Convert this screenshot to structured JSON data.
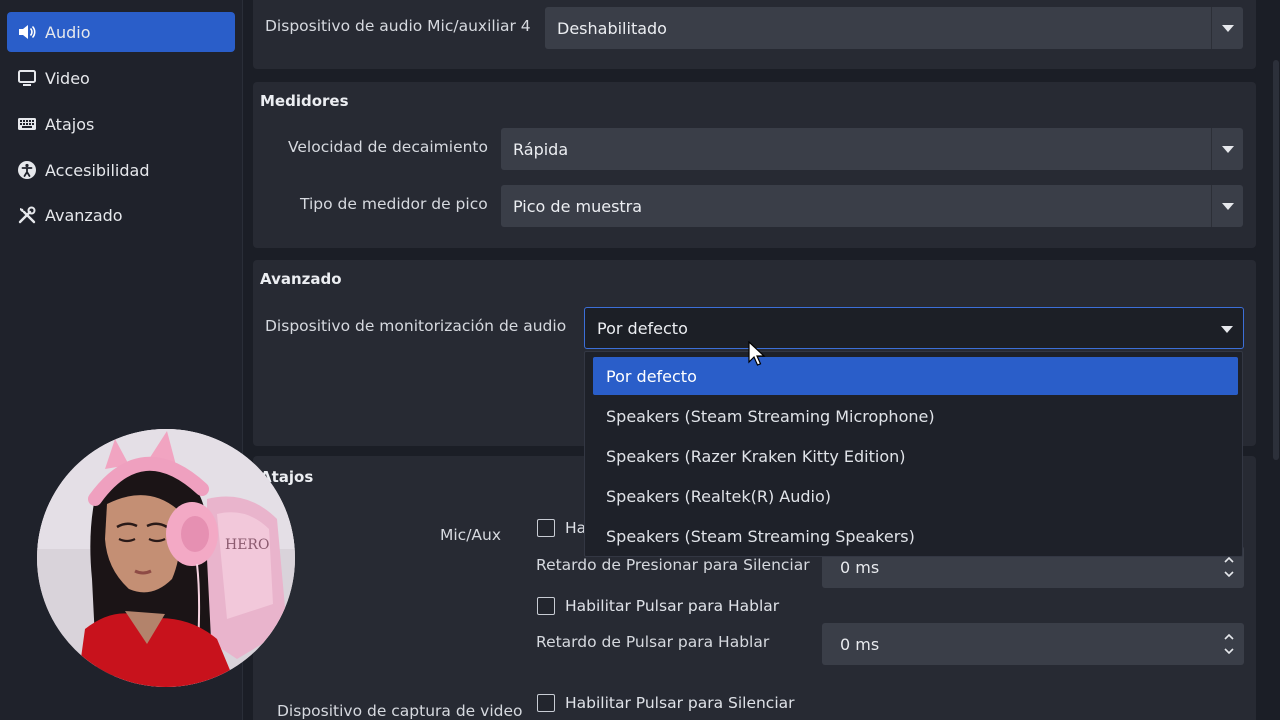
{
  "sidebar": {
    "items": [
      {
        "label": "Audio",
        "icon": "speaker-icon",
        "active": true
      },
      {
        "label": "Video",
        "icon": "monitor-icon",
        "active": false
      },
      {
        "label": "Atajos",
        "icon": "keyboard-icon",
        "active": false
      },
      {
        "label": "Accesibilidad",
        "icon": "accessibility-icon",
        "active": false
      },
      {
        "label": "Avanzado",
        "icon": "tools-icon",
        "active": false
      }
    ]
  },
  "top_row": {
    "label": "Dispositivo de audio Mic/auxiliar 4",
    "value": "Deshabilitado"
  },
  "medidores": {
    "title": "Medidores",
    "decay_label": "Velocidad de decaimiento",
    "decay_value": "Rápida",
    "peak_label": "Tipo de medidor de pico",
    "peak_value": "Pico de muestra"
  },
  "avanzado": {
    "title": "Avanzado",
    "monitor_label": "Dispositivo de monitorización de audio",
    "monitor_value": "Por defecto",
    "options": [
      "Por defecto",
      "Speakers (Steam Streaming Microphone)",
      "Speakers (Razer Kraken Kitty Edition)",
      "Speakers (Realtek(R) Audio)",
      "Speakers (Steam Streaming Speakers)"
    ]
  },
  "atajos": {
    "title": "Atajos",
    "mic_aux_label": "Mic/Aux",
    "mute_checkbox_partial": "Ha",
    "mute_delay_label": "Retardo de Presionar para Silenciar",
    "mute_delay_value": "0 ms",
    "ptt_checkbox": "Habilitar Pulsar para Hablar",
    "ptt_delay_label": "Retardo de Pulsar para Hablar",
    "ptt_delay_value": "0 ms",
    "video_capture_label": "Dispositivo de captura de video",
    "video_mute_checkbox": "Habilitar Pulsar para Silenciar"
  },
  "colors": {
    "accent": "#2a5ec9",
    "background": "#1b1e26",
    "panel": "#272a33",
    "field": "#3a3e48"
  }
}
